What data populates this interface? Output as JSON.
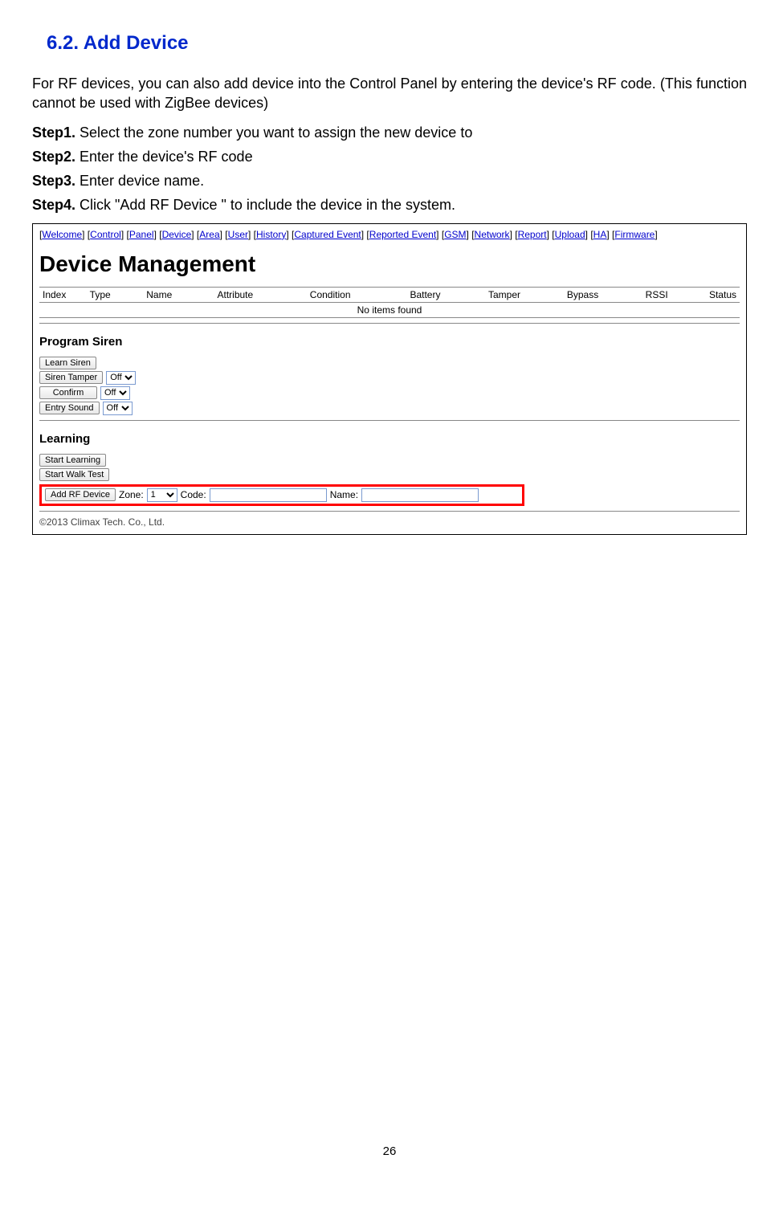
{
  "section": {
    "title": "6.2. Add Device"
  },
  "intro": "For RF devices, you can also add device into the Control Panel by entering the device's RF code. (This function cannot be used with ZigBee devices)",
  "steps": {
    "s1_label": "Step1.",
    "s1_text": " Select the zone number you want to assign the new device to",
    "s2_label": "Step2.",
    "s2_text": " Enter the device's RF code",
    "s3_label": "Step3.",
    "s3_text": " Enter device name.",
    "s4_label": "Step4.",
    "s4_text": " Click \"Add RF Device \" to include the device in the system."
  },
  "nav": {
    "items": [
      "Welcome",
      "Control",
      "Panel",
      "Device",
      "Area",
      "User",
      "History",
      "Captured Event",
      "Reported Event",
      "GSM",
      "Network",
      "Report",
      "Upload",
      "HA",
      "Firmware"
    ]
  },
  "page": {
    "heading": "Device Management",
    "columns": [
      "Index",
      "Type",
      "Name",
      "Attribute",
      "Condition",
      "Battery",
      "Tamper",
      "Bypass",
      "RSSI",
      "Status"
    ],
    "noitems": "No items found"
  },
  "siren": {
    "heading": "Program Siren",
    "learn": "Learn Siren",
    "tamper_label": "Siren Tamper",
    "tamper_value": "Off",
    "confirm_label": "Confirm",
    "confirm_value": "Off",
    "entry_label": "Entry Sound",
    "entry_value": "Off"
  },
  "learning": {
    "heading": "Learning",
    "start": "Start Learning",
    "walk": "Start Walk Test",
    "add_rf": "Add RF Device",
    "zone_label": "Zone:",
    "zone_value": "1",
    "code_label": "Code:",
    "code_value": "",
    "name_label": "Name:",
    "name_value": ""
  },
  "copyright": "©2013 Climax Tech. Co., Ltd.",
  "colors": {
    "title_blue": "#0028cc",
    "link_blue": "#0000cc",
    "highlight_red": "#ff0000"
  },
  "pagenum": "26"
}
